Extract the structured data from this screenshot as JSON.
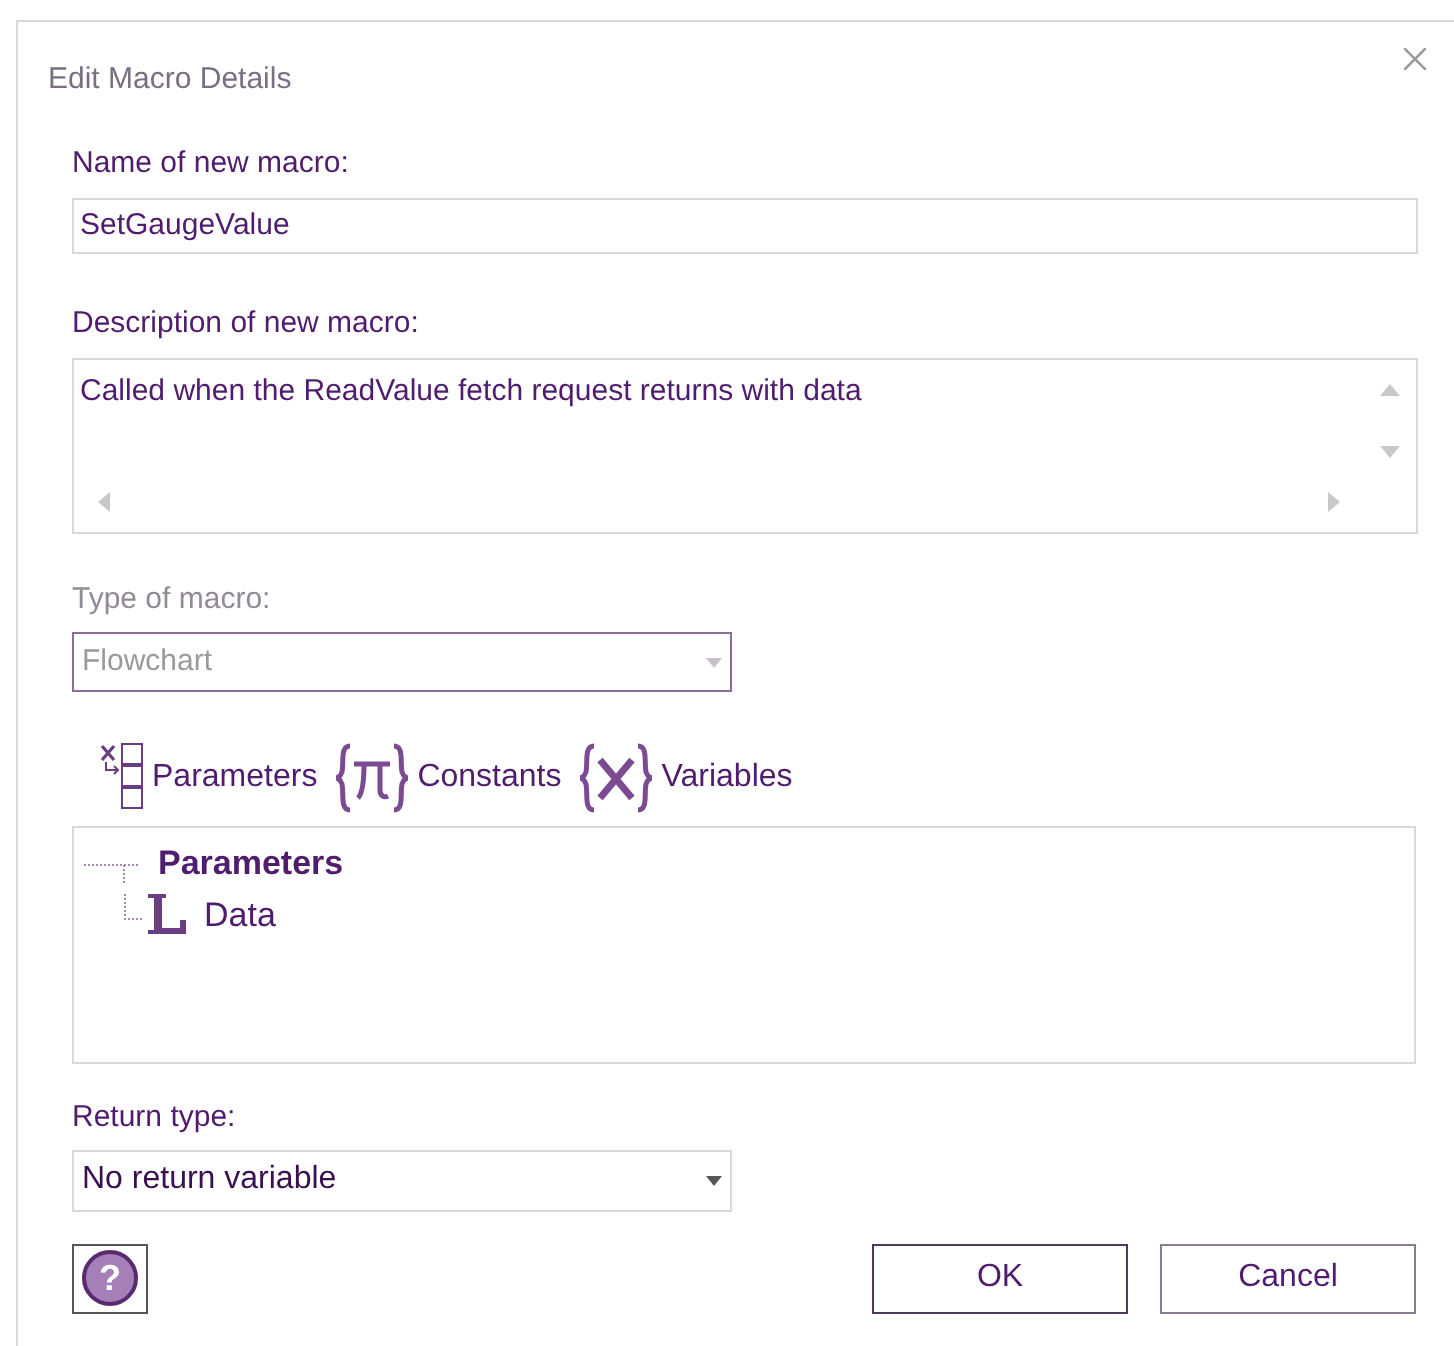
{
  "window": {
    "title": "Edit Macro Details"
  },
  "name_field": {
    "label": "Name of new macro:",
    "value": "SetGaugeValue"
  },
  "description_field": {
    "label": "Description of new macro:",
    "value": "Called when the ReadValue fetch request returns with data"
  },
  "type_field": {
    "label": "Type of macro:",
    "value": "Flowchart",
    "disabled": true
  },
  "toolbar": [
    {
      "kind": "parameters",
      "label": "Parameters"
    },
    {
      "kind": "constants",
      "label": "Constants"
    },
    {
      "kind": "variables",
      "label": "Variables"
    }
  ],
  "tree": [
    {
      "label": "Parameters",
      "children": [
        {
          "kind": "local",
          "label": "Data"
        }
      ]
    }
  ],
  "return_field": {
    "label": "Return type:",
    "value": "No return variable",
    "disabled": false
  },
  "help_button": {
    "label": "?"
  },
  "buttons": [
    "OK",
    "Cancel"
  ]
}
